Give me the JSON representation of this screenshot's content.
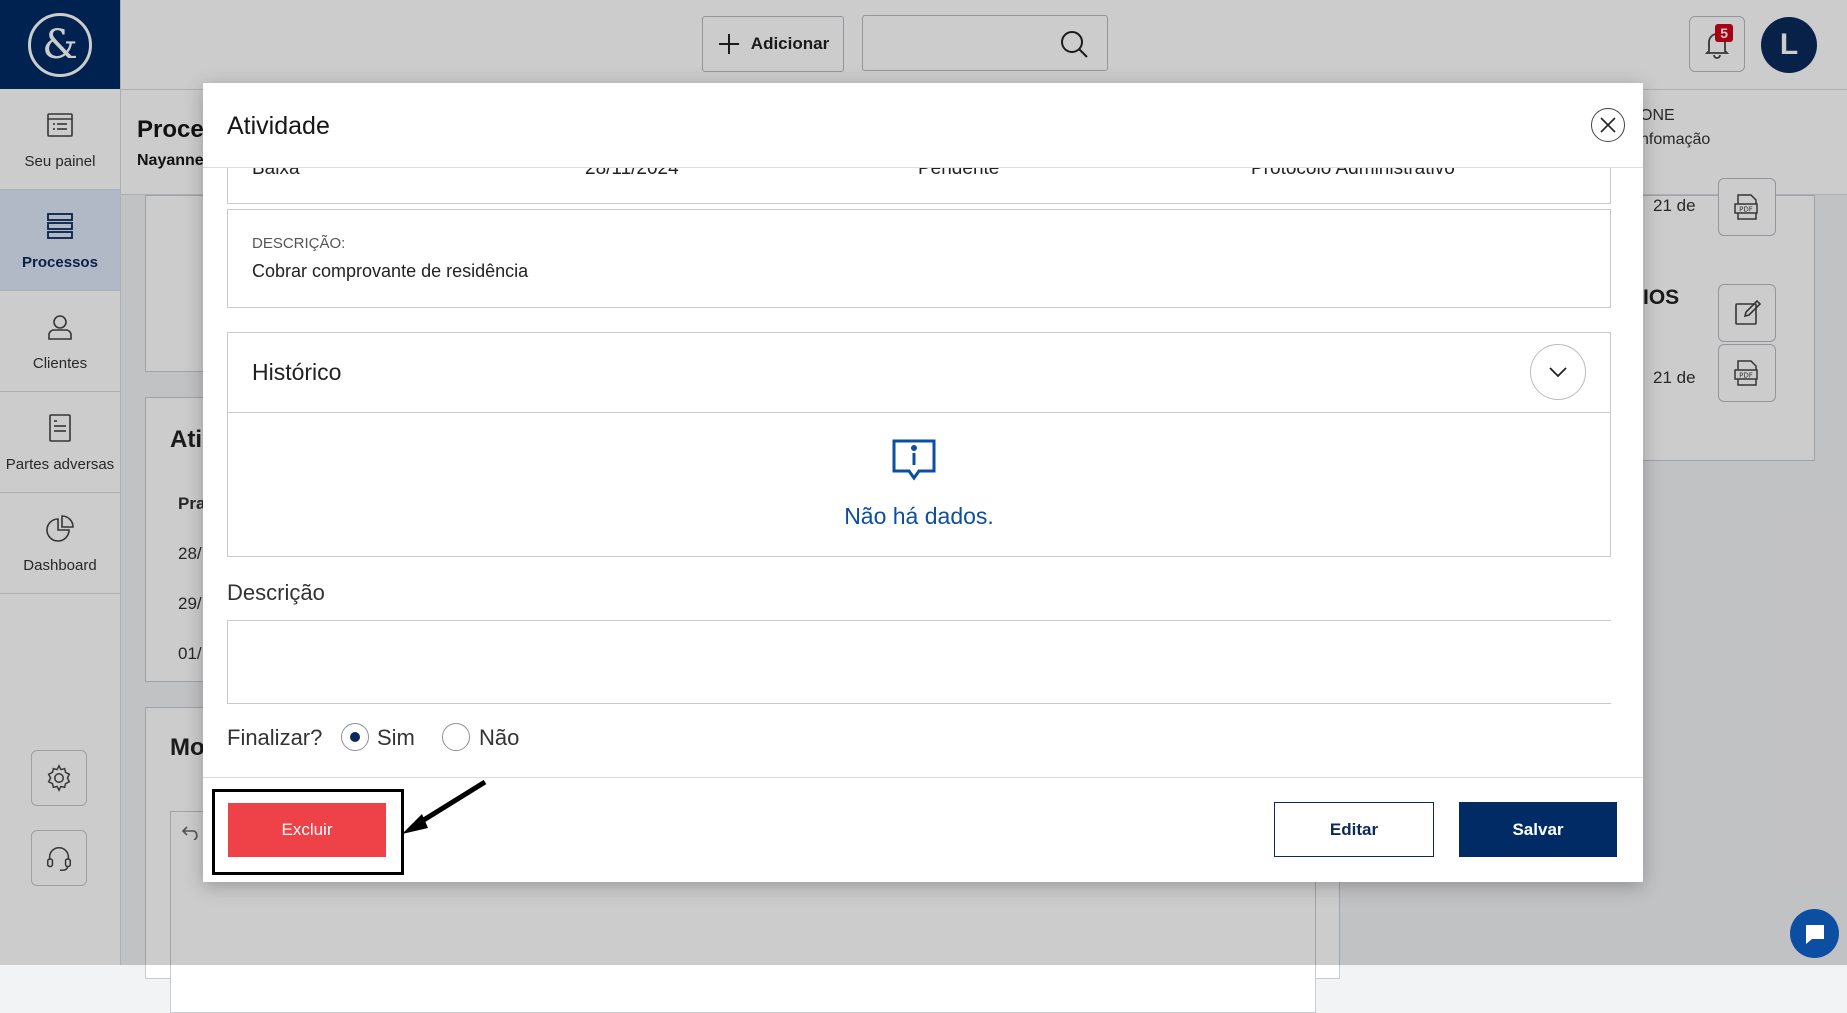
{
  "sidebar": {
    "logo_text": "&",
    "items": [
      {
        "label": "Seu painel",
        "icon": "list-icon"
      },
      {
        "label": "Processos",
        "icon": "stack-icon",
        "active": true
      },
      {
        "label": "Clientes",
        "icon": "user-icon"
      },
      {
        "label": "Partes adversas",
        "icon": "document-icon"
      },
      {
        "label": "Dashboard",
        "icon": "pie-chart-icon"
      }
    ],
    "bottom_icons": [
      "gear-icon",
      "headset-icon"
    ]
  },
  "topbar": {
    "add_label": "Adicionar",
    "search_placeholder": "",
    "notification_count": "5",
    "avatar_initial": "L"
  },
  "background": {
    "process_title": "Proces",
    "process_subtitle": "Nayanne",
    "right_label_1": "ONE",
    "right_label_2": "nfomação",
    "activities_title": "Ati",
    "activities_col": "Pra",
    "activities_rows": [
      "28/",
      "29/",
      "01/"
    ],
    "more_title": "Mo",
    "side_title": "IOS",
    "side_date_1": "21 de",
    "side_date_2": "21 de"
  },
  "modal": {
    "title": "Atividade",
    "row": {
      "type": "Baixa",
      "date": "28/11/2024",
      "status": "Pendente",
      "category": "Protocolo Administrativo"
    },
    "description_label": "DESCRIÇÃO:",
    "description_value": "Cobrar comprovante de residência",
    "history_title": "Histórico",
    "no_data": "Não há dados.",
    "field_description_label": "Descrição",
    "field_description_value": "",
    "finalize_label": "Finalizar?",
    "finalize_options": [
      {
        "label": "Sim",
        "checked": true
      },
      {
        "label": "Não",
        "checked": false
      }
    ],
    "buttons": {
      "delete": "Excluir",
      "edit": "Editar",
      "save": "Salvar"
    }
  },
  "colors": {
    "primary": "#002b65",
    "danger": "#ee4148",
    "info": "#0b4ea2"
  }
}
